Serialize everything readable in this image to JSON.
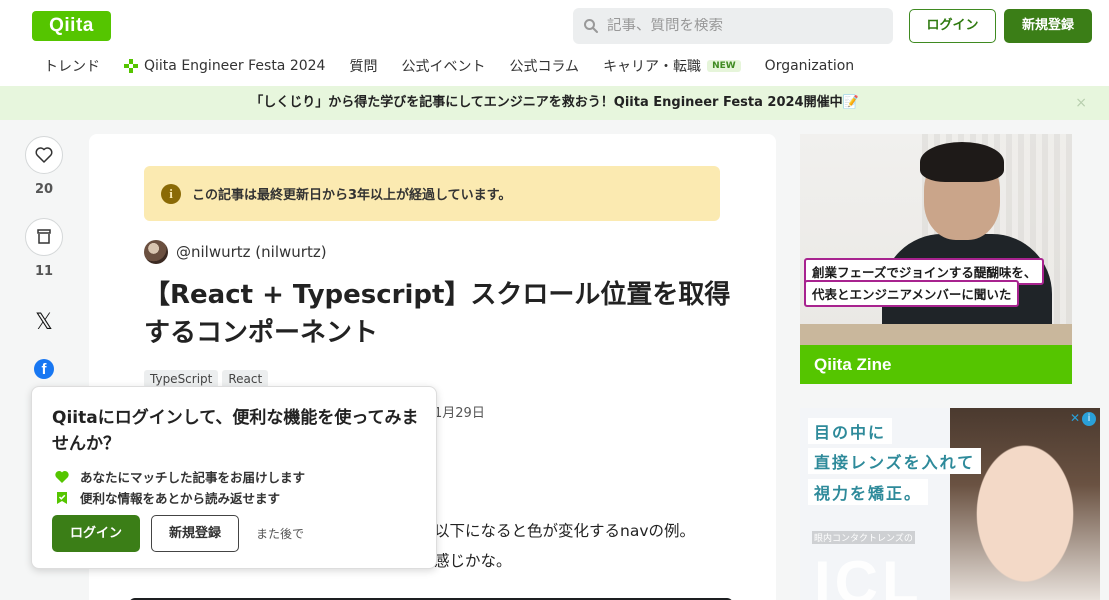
{
  "header": {
    "logo": "Qiita",
    "search_placeholder": "記事、質問を検索",
    "login_label": "ログイン",
    "signup_label": "新規登録"
  },
  "nav": {
    "trend": "トレンド",
    "festa": "Qiita Engineer Festa 2024",
    "question": "質問",
    "events": "公式イベント",
    "column": "公式コラム",
    "career": "キャリア・転職",
    "new_badge": "NEW",
    "organization": "Organization"
  },
  "banner": {
    "text": "「しくじり」から得た学びを記事にしてエンジニアを救おう！Qiita Engineer Festa 2024開催中📝",
    "close": "×"
  },
  "rail": {
    "like_count": "20",
    "stock_count": "11",
    "x_label": "𝕏",
    "fb_label": "f"
  },
  "article": {
    "notice": "この記事は最終更新日から3年以上が経過しています。",
    "author": "@nilwurtz (nilwurtz)",
    "title": "【React + Typescript】スクロール位置を取得するコンポーネント",
    "tags": [
      "TypeScript",
      "React"
    ],
    "date_fragment": "1月29日",
    "body_line1": "以下になると色が変化するnavの例。",
    "body_line2": "感じかな。"
  },
  "popup": {
    "title": "Qiitaにログインして、便利な機能を使ってみませんか？",
    "item1": "あなたにマッチした記事をお届けします",
    "item2": "便利な情報をあとから読み返せます",
    "login_label": "ログイン",
    "signup_label": "新規登録",
    "later_label": "また後で"
  },
  "ads": {
    "zine_caption1": "創業フェーズでジョインする醍醐味を、",
    "zine_caption2": "代表とエンジニアメンバーに聞いた",
    "zine_brand": "Qiita Zine",
    "lens_line1": "目の中に",
    "lens_line2": "直接レンズを入れて",
    "lens_line3": "視力を矯正。",
    "lens_small": "眼内コンタクトレンズの",
    "lens_brand": "ICL"
  },
  "colors": {
    "brand_green": "#55c500",
    "button_green": "#3b7e17",
    "notice_yellow": "#fbeab1",
    "banner_green": "#e7f6dd"
  }
}
